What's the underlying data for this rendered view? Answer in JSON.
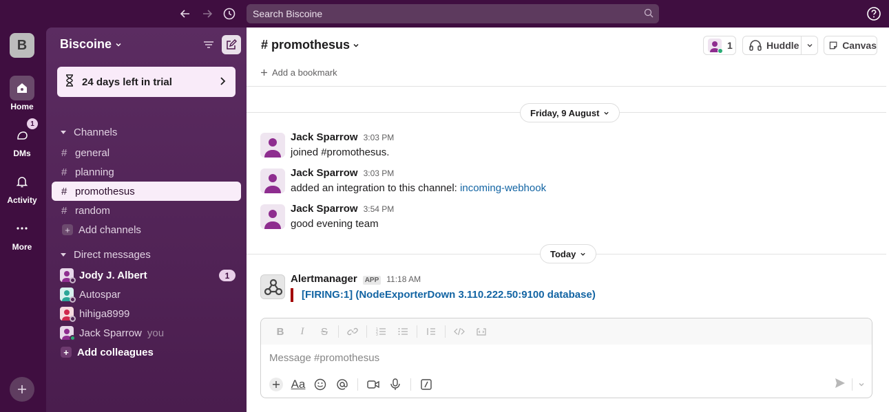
{
  "topbar": {
    "search_placeholder": "Search Biscoine"
  },
  "rail": {
    "workspace_initial": "B",
    "items": [
      {
        "label": "Home"
      },
      {
        "label": "DMs",
        "badge": "1"
      },
      {
        "label": "Activity"
      },
      {
        "label": "More"
      }
    ]
  },
  "sidebar": {
    "workspace_name": "Biscoine",
    "trial": "24 days left in trial",
    "channels_header": "Channels",
    "channels": [
      {
        "name": "general"
      },
      {
        "name": "planning"
      },
      {
        "name": "promothesus"
      },
      {
        "name": "random"
      }
    ],
    "add_channels": "Add channels",
    "dms_header": "Direct messages",
    "dms": [
      {
        "name": "Jody J. Albert",
        "badge": "1"
      },
      {
        "name": "Autospar"
      },
      {
        "name": "hihiga8999"
      },
      {
        "name": "Jack Sparrow",
        "suffix": "you"
      }
    ],
    "add_colleagues": "Add colleagues"
  },
  "channel": {
    "title": "# promothesus",
    "members_count": "1",
    "huddle_label": "Huddle",
    "canvas_label": "Canvas",
    "bookmark_label": "Add a bookmark"
  },
  "messages": {
    "date1": "Friday, 9 August",
    "date2": "Today",
    "list": [
      {
        "author": "Jack Sparrow",
        "time": "3:03 PM",
        "text": "joined #promothesus."
      },
      {
        "author": "Jack Sparrow",
        "time": "3:03 PM",
        "text": "added an integration to this channel: ",
        "link": "incoming-webhook"
      },
      {
        "author": "Jack Sparrow",
        "time": "3:54 PM",
        "text": "good evening team"
      },
      {
        "author": "Alertmanager",
        "tag": "APP",
        "time": "11:18 AM",
        "text": "[FIRING:1]  (NodeExporterDown 3.110.222.50:9100 database)"
      }
    ]
  },
  "composer": {
    "placeholder": "Message #promothesus"
  },
  "colors": {
    "sidebar": "#4a154b",
    "active_channel": "#f9edf9",
    "link": "#1264a3",
    "firing_bar": "#a30200"
  }
}
